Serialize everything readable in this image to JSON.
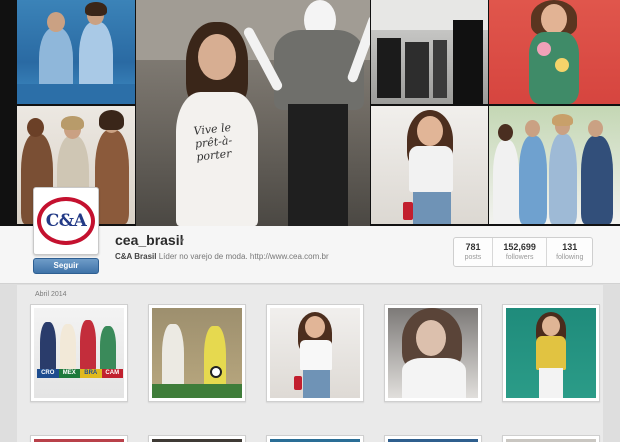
{
  "profile": {
    "username": "cea_brasil",
    "dropdown_caret": "▾",
    "bio_name": "C&A Brasil",
    "bio_text": "Líder no varejo de moda.",
    "bio_link": "http://www.cea.com.br",
    "logo_text": "C&A",
    "follow_label": "Seguir"
  },
  "stats": [
    {
      "value": "781",
      "label": "posts"
    },
    {
      "value": "152,699",
      "label": "followers"
    },
    {
      "value": "131",
      "label": "following"
    }
  ],
  "feed": {
    "section_label": "Abril 2014",
    "banner": [
      "CRO",
      "MEX",
      "BRA",
      "CAM"
    ]
  },
  "mosaic_shirt_text": "Vive le prêt-à-porter",
  "colors": {
    "brand_red": "#c4112f",
    "brand_blue": "#233a86",
    "follow_button": "#3f73a8"
  }
}
